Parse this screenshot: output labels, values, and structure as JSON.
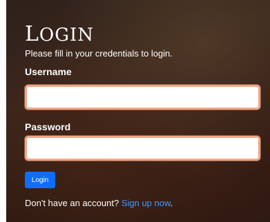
{
  "login": {
    "title_first": "L",
    "title_rest": "OGIN",
    "subtitle": "Please fill in your credentials to login.",
    "username_label": "Username",
    "username_value": "",
    "password_label": "Password",
    "password_value": "",
    "button_label": "Login",
    "signup_prefix": "Don't have an account? ",
    "signup_link": "Sign up now",
    "signup_suffix": "."
  },
  "colors": {
    "accent": "#0d6efd",
    "input_border": "#f0a684",
    "link": "#3f9bff"
  }
}
